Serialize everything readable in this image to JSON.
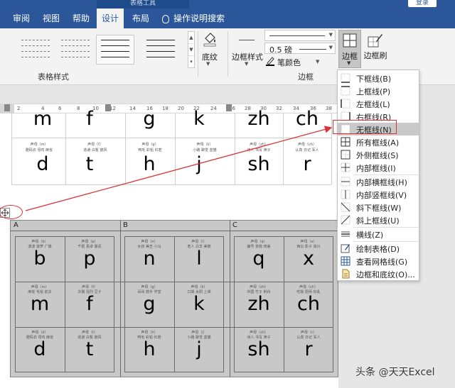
{
  "window": {
    "context_tab_group": "表格工具",
    "login_button": "登录"
  },
  "tabs": [
    {
      "label": "审阅",
      "active": false
    },
    {
      "label": "视图",
      "active": false
    },
    {
      "label": "帮助",
      "active": false
    },
    {
      "label": "设计",
      "active": true
    },
    {
      "label": "布局",
      "active": false
    }
  ],
  "tell_me": "操作说明搜索",
  "ribbon": {
    "groups": {
      "table_styles": "表格样式",
      "borders": "边框"
    },
    "shading": "底纹",
    "border_styles": "边框样式",
    "line_weight": "0.5 磅",
    "pen_color": "笔颜色",
    "borders_button": "边框",
    "border_painter": "边框刷"
  },
  "ruler_ticks": [
    "2",
    "4",
    "6",
    "8",
    "10",
    "12",
    "14",
    "16",
    "18",
    "20",
    "22",
    "24",
    "26",
    "28",
    "30",
    "32",
    "34",
    "36",
    "38"
  ],
  "upper_table": {
    "top_letters": [
      "m",
      "f",
      "g",
      "k",
      "zh",
      "ch"
    ],
    "phrase_row": [
      {
        "label": "声母（m）",
        "words": "蹬码衣 母鸡 麻雀"
      },
      {
        "label": "声母（f）",
        "words": "逃避 白皙 披风"
      },
      {
        "label": "声母（g）",
        "words": "鸭毛 彩铅 红若"
      },
      {
        "label": "声母（k）",
        "words": "小路 聊觉 蓝猫"
      },
      {
        "label": "声母（zh）",
        "words": "诗人 书写 筛子"
      },
      {
        "label": "声母（ch）",
        "words": "认真 日记 军人"
      }
    ],
    "bottom_letters": [
      "d",
      "t",
      "h",
      "j",
      "sh",
      "r"
    ]
  },
  "lower_table": {
    "columns": [
      "A",
      "B",
      "C"
    ],
    "rows": [
      {
        "letters": [
          "b",
          "p",
          "n",
          "l",
          "q",
          "x"
        ],
        "phrases": [
          {
            "label": "声母（b）",
            "words": "波波 菠萝 广播"
          },
          {
            "label": "声母（p）",
            "words": "千姬 嘉卓 暴泥"
          },
          {
            "label": "声母（n）",
            "words": "女孩 美丑 小马"
          },
          {
            "label": "声母（l）",
            "words": "老人 白羊 美丽"
          },
          {
            "label": "声母（q）",
            "words": "编号 苍施 修差"
          },
          {
            "label": "声母（x）",
            "words": "西瓜 影子 高兴"
          }
        ]
      },
      {
        "letters": [
          "m",
          "f",
          "g",
          "k",
          "zh",
          "ch"
        ],
        "phrases": [
          {
            "label": "声母（m）",
            "words": "麻雀 毛毯 前夫"
          },
          {
            "label": "声母（f）",
            "words": "衣服 强烈 豆子"
          },
          {
            "label": "声母（g）",
            "words": "哥哥 鼓手 学堂"
          },
          {
            "label": "声母（k）",
            "words": "口袋 太阳 上课"
          },
          {
            "label": "声母（zh）",
            "words": "中国 竹子 荆舟"
          },
          {
            "label": "声母（ch）",
            "words": "吃饭 厨师 好乱"
          }
        ]
      },
      {
        "letters": [
          "d",
          "t",
          "h",
          "j",
          "sh",
          "r"
        ],
        "phrases": [
          {
            "label": "声母（d）",
            "words": "蹬码衣 母鸡 麻雀"
          },
          {
            "label": "声母（t）",
            "words": "逃避 白皙 披风"
          },
          {
            "label": "声母（h）",
            "words": "鸭毛 彩铅 红若"
          },
          {
            "label": "声母（j）",
            "words": "小路 聊觉 蓝猫"
          },
          {
            "label": "声母（sh）",
            "words": "诗人 书写 筛子"
          },
          {
            "label": "声母（r）",
            "words": "认真 日记 军人"
          }
        ]
      }
    ]
  },
  "border_menu": [
    {
      "icon": "bottom-border-icon",
      "label": "下框线(B)"
    },
    {
      "icon": "top-border-icon",
      "label": "上框线(P)"
    },
    {
      "icon": "left-border-icon",
      "label": "左框线(L)"
    },
    {
      "icon": "right-border-icon",
      "label": "右框线(R)"
    },
    {
      "icon": "no-border-icon",
      "label": "无框线(N)"
    },
    {
      "icon": "all-borders-icon",
      "label": "所有框线(A)"
    },
    {
      "icon": "outside-borders-icon",
      "label": "外侧框线(S)"
    },
    {
      "icon": "inside-borders-icon",
      "label": "内部框线(I)"
    },
    {
      "icon": "inside-horizontal-border-icon",
      "label": "内部横框线(H)"
    },
    {
      "icon": "inside-vertical-border-icon",
      "label": "内部竖框线(V)"
    },
    {
      "icon": "diagonal-down-border-icon",
      "label": "斜下框线(W)"
    },
    {
      "icon": "diagonal-up-border-icon",
      "label": "斜上框线(U)"
    },
    {
      "icon": "horizontal-line-icon",
      "label": "横线(Z)"
    },
    {
      "icon": "draw-table-icon",
      "label": "绘制表格(D)"
    },
    {
      "icon": "view-gridlines-icon",
      "label": "查看网格线(G)"
    },
    {
      "icon": "borders-and-shading-icon",
      "label": "边框和底纹(O)..."
    }
  ],
  "watermark": "头条 @天天Excel",
  "colors": {
    "ribbon_blue": "#2b579a",
    "annotation_red": "#dd3333"
  }
}
